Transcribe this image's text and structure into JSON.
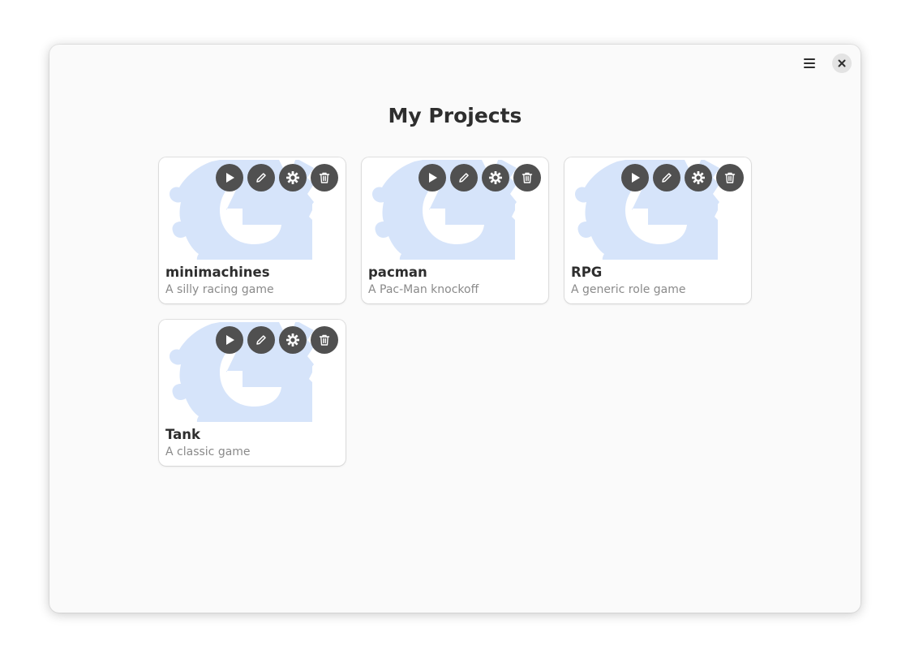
{
  "header": {
    "menu_icon": "hamburger-menu-icon",
    "close_icon": "close-icon"
  },
  "page": {
    "title": "My Projects"
  },
  "colors": {
    "thumbnail_logo": "#d6e4fa",
    "action_button": "#505050"
  },
  "projects": [
    {
      "name": "minimachines",
      "description": "A silly racing game"
    },
    {
      "name": "pacman",
      "description": "A Pac-Man knockoff"
    },
    {
      "name": "RPG",
      "description": "A generic role game"
    },
    {
      "name": "Tank",
      "description": "A classic game"
    }
  ],
  "card_actions": [
    {
      "icon": "play-icon"
    },
    {
      "icon": "edit-pencil-icon"
    },
    {
      "icon": "settings-gear-icon"
    },
    {
      "icon": "delete-trash-icon"
    }
  ]
}
